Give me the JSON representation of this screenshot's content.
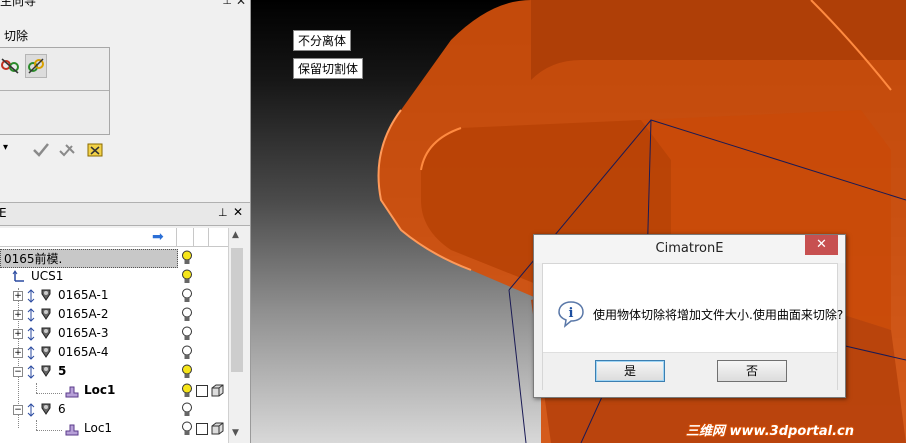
{
  "left_panel": {
    "top_title": "生向导",
    "cut_label": "切除",
    "tree_header_label": "E",
    "tree_rows": [
      {
        "name": "0165前模.",
        "selected": true
      },
      {
        "name": "UCS1"
      },
      {
        "name": "0165A-1"
      },
      {
        "name": "0165A-2"
      },
      {
        "name": "0165A-3"
      },
      {
        "name": "0165A-4"
      },
      {
        "name": "5"
      },
      {
        "name": "Loc1"
      },
      {
        "name": "6"
      },
      {
        "name": "Loc1"
      }
    ]
  },
  "viewport": {
    "tags": [
      "不分离体",
      "保留切割体"
    ],
    "body_color": "#e0520f"
  },
  "dialog": {
    "title": "CimatronE",
    "close_glyph": "✕",
    "message": "使用物体切除将增加文件大小.使用曲面来切除?",
    "yes_label": "是",
    "no_label": "否"
  },
  "watermark": "三维网 www.3dportal.cn",
  "icons": [
    "cut-tool-icon",
    "cut-tool-active-icon",
    "dropdown-icon",
    "ok-check-icon",
    "apply-icon",
    "cancel-icon",
    "pin-icon",
    "close-icon",
    "arrow-right-icon",
    "bulb-icon",
    "axis-icon",
    "part-icon",
    "cube-icon",
    "info-icon"
  ]
}
